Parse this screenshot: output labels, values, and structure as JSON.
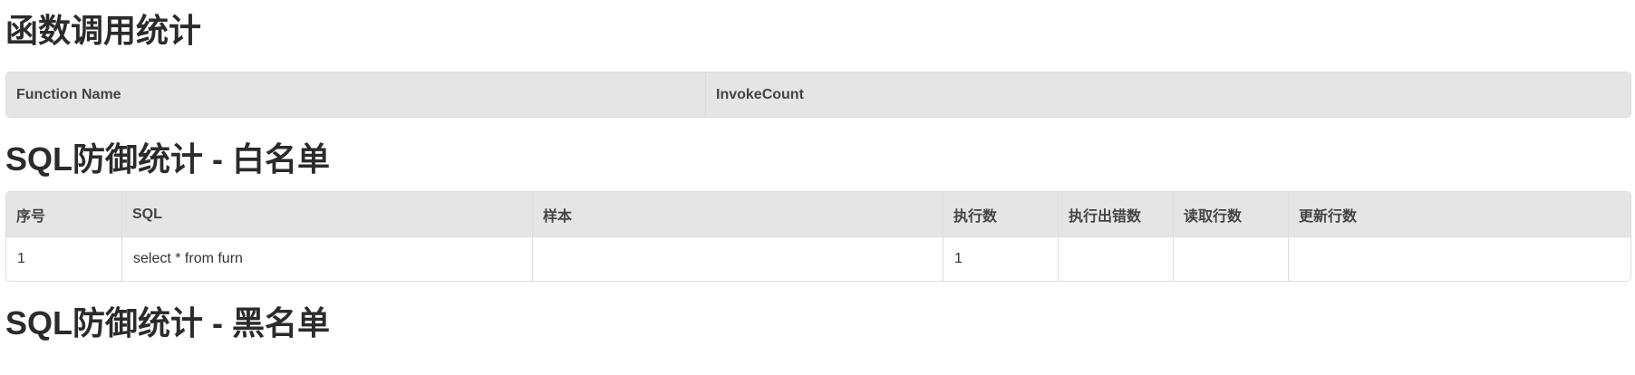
{
  "sections": {
    "functions": {
      "title": "函数调用统计",
      "headers": [
        "Function Name",
        "InvokeCount"
      ]
    },
    "whitelist": {
      "title": "SQL防御统计 - 白名单",
      "headers": [
        "序号",
        "SQL",
        "样本",
        "执行数",
        "执行出错数",
        "读取行数",
        "更新行数"
      ],
      "rows": [
        [
          "1",
          "select * from furn",
          "",
          "1",
          "",
          "",
          ""
        ]
      ]
    },
    "blacklist": {
      "title": "SQL防御统计 - 黑名单"
    }
  }
}
